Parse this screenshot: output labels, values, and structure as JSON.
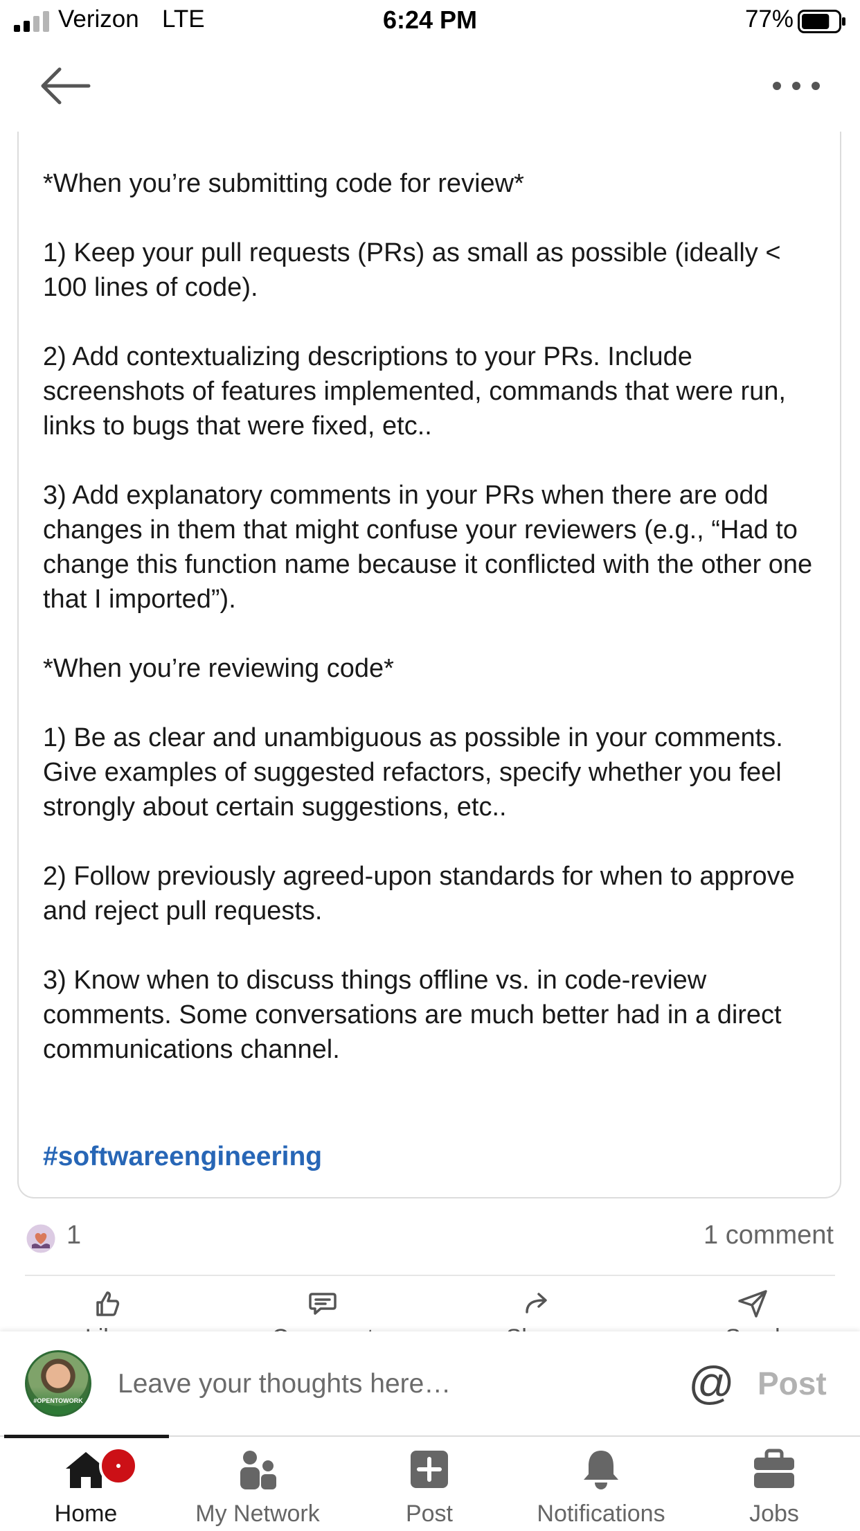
{
  "status_bar": {
    "carrier": "Verizon",
    "network": "LTE",
    "time": "6:24 PM",
    "battery": "77%",
    "battery_level": 0.77
  },
  "nav": {
    "back_icon": "arrow-left-icon",
    "more_icon": "ellipsis-icon"
  },
  "post": {
    "body": "participating in code review.\n\n*When you’re submitting code for review*\n\n1) Keep your pull requests (PRs) as small as possible (ideally < 100 lines of code).\n\n2) Add contextualizing descriptions to your PRs. Include screenshots of features implemented, commands that were run, links to bugs that were fixed, etc..\n\n3) Add explanatory comments in your PRs when there are odd changes in them that might confuse your reviewers (e.g., “Had to change this function name because it conflicted with the other one that I imported”).\n\n*When you’re reviewing code*\n\n1) Be as clear and unambiguous as possible in your comments. Give examples of suggested refactors, specify whether you feel strongly about certain suggestions, etc..\n\n2) Follow previously agreed-upon standards for when to approve and reject pull requests.\n\n3) Know when to discuss things offline vs. in code-review comments. Some conversations are much better had in a direct communications channel.",
    "hashtag": "#softwareengineering"
  },
  "social": {
    "reaction_icon": "love-reaction-icon",
    "reaction_count": "1",
    "comment_count": "1 comment"
  },
  "actions": [
    {
      "label": "Like",
      "icon": "thumbs-up-icon"
    },
    {
      "label": "Comment",
      "icon": "comment-bubble-icon"
    },
    {
      "label": "Share",
      "icon": "share-arrow-icon"
    },
    {
      "label": "Send",
      "icon": "send-icon"
    }
  ],
  "comment_box": {
    "placeholder": "Leave your thoughts here…",
    "avatar_badge": "#OPENTOWORK",
    "mention": "@",
    "post_label": "Post"
  },
  "tabs": [
    {
      "label": "Home",
      "icon": "home-icon",
      "active": true
    },
    {
      "label": "My Network",
      "icon": "people-icon"
    },
    {
      "label": "Post",
      "icon": "plus-square-icon"
    },
    {
      "label": "Notifications",
      "icon": "bell-icon"
    },
    {
      "label": "Jobs",
      "icon": "briefcase-icon"
    }
  ],
  "colors": {
    "hashtag": "#2766b6",
    "badge": "#cc1016",
    "text": "#191919",
    "muted": "#666666"
  }
}
